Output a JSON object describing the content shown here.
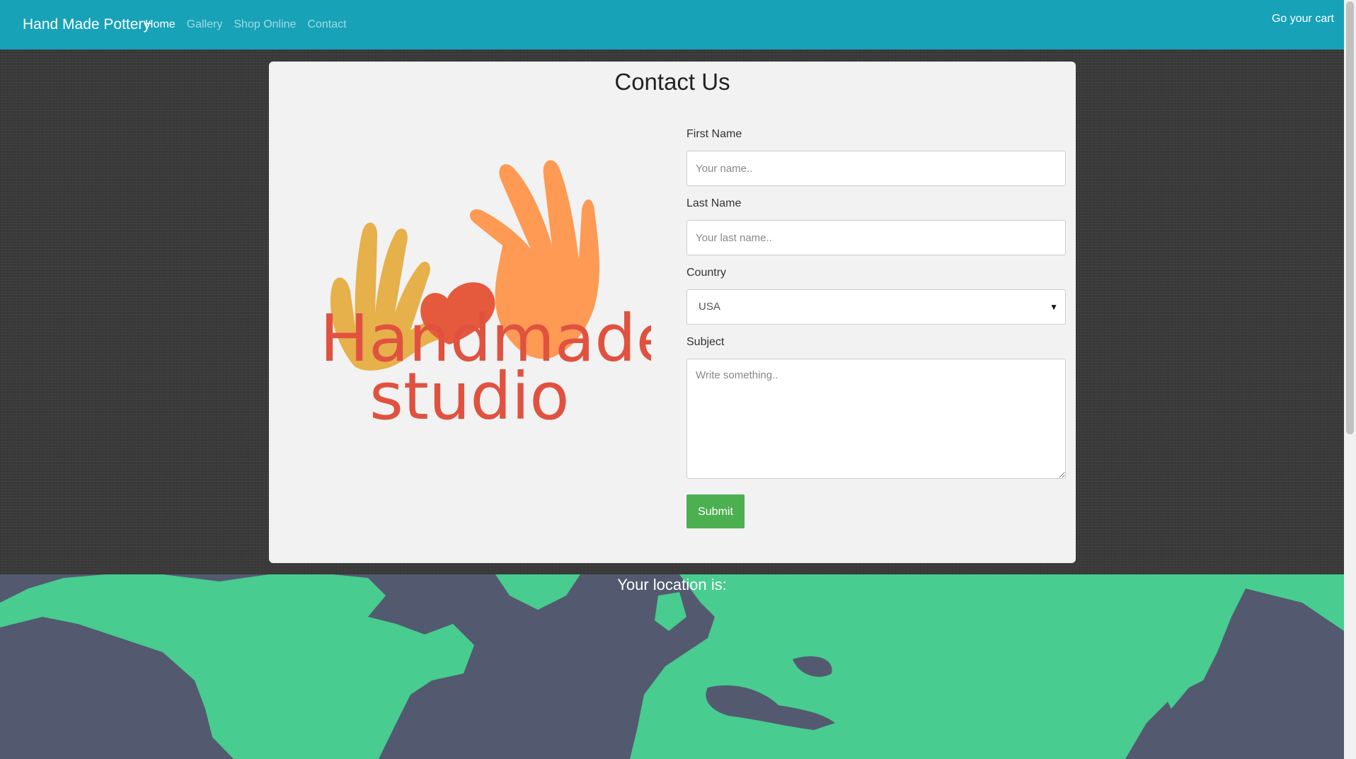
{
  "navbar": {
    "brand": "Hand Made Pottery",
    "links": [
      "Home",
      "Gallery",
      "Shop Online",
      "Contact"
    ],
    "active_link": "Home",
    "cart_label": "Go your cart"
  },
  "contact": {
    "title": "Contact Us",
    "logo": {
      "line1": "Handmade",
      "line2": "studio"
    },
    "first_name": {
      "label": "First Name",
      "placeholder": "Your name.."
    },
    "last_name": {
      "label": "Last Name",
      "placeholder": "Your last name.."
    },
    "country": {
      "label": "Country",
      "value": "USA"
    },
    "subject": {
      "label": "Subject",
      "placeholder": "Write something.."
    },
    "submit_label": "Submit"
  },
  "map": {
    "title": "Your location is:"
  },
  "colors": {
    "navbar": "#17a2b8",
    "submit": "#4caf50",
    "land": "#48cc8f",
    "water": "#535a70"
  }
}
